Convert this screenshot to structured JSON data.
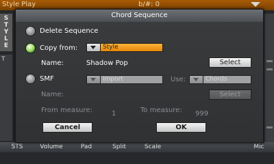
{
  "background": {
    "top_bar": {
      "title": "Style Play",
      "measure": "b/#: 0"
    },
    "side_label": "STYLE",
    "left_char": "T",
    "bottom_tabs": [
      "STS",
      "Volume",
      "Pad",
      "Split",
      "Scale",
      "Mic"
    ]
  },
  "dialog": {
    "title": "Chord Sequence",
    "delete_label": "Delete Sequence",
    "copy_from": {
      "label": "Copy from:",
      "selected": "Style",
      "name_label": "Name:",
      "name_value": "Shadow Pop",
      "select_button": "Select"
    },
    "smf": {
      "label": "SMF",
      "selected": "Import",
      "use_label": "Use:",
      "use_selected": "Chords",
      "name_label": "Name:",
      "select_button": "Select"
    },
    "from_measure": {
      "label": "From measure:",
      "value": "1"
    },
    "to_measure": {
      "label": "To measure:",
      "value": "999"
    },
    "cancel_button": "Cancel",
    "ok_button": "OK",
    "selected_option": "copy_from"
  },
  "colors": {
    "accent_orange": "#f29a1a",
    "radio_on": "#8fd44e",
    "title_bar": "#5c6064"
  }
}
